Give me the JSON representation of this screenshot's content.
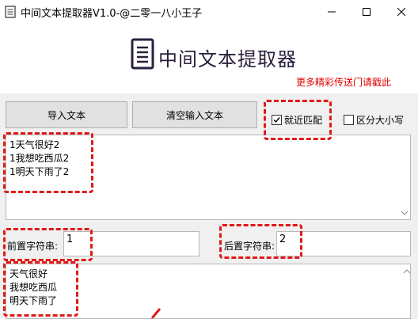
{
  "window": {
    "title": "中间文本提取器V1.0-@二零一八小王子",
    "icons": {
      "app": "document-icon",
      "minimize": "minimize-icon",
      "maximize": "maximize-icon",
      "close": "close-icon"
    }
  },
  "header": {
    "heading": "中间文本提取器",
    "promo_link": "更多精彩传送门请戳此"
  },
  "toolbar": {
    "import_label": "导入文本",
    "clear_label": "清空输入文本",
    "nearest_match_label": "就近匹配",
    "nearest_match_checked": true,
    "case_sensitive_label": "区分大小写",
    "case_sensitive_checked": false
  },
  "input_text": "1天气很好2\n1我想吃西瓜2\n1明天下雨了2",
  "prefix": {
    "label": "前置字符串:",
    "value": "1"
  },
  "suffix": {
    "label": "后置字符串:",
    "value": "2"
  },
  "output_text": "天气很好\n我想吃西瓜\n明天下雨了",
  "colors": {
    "annotation": "#e11919",
    "promo": "#e00000",
    "heading": "#2a1f3d"
  }
}
